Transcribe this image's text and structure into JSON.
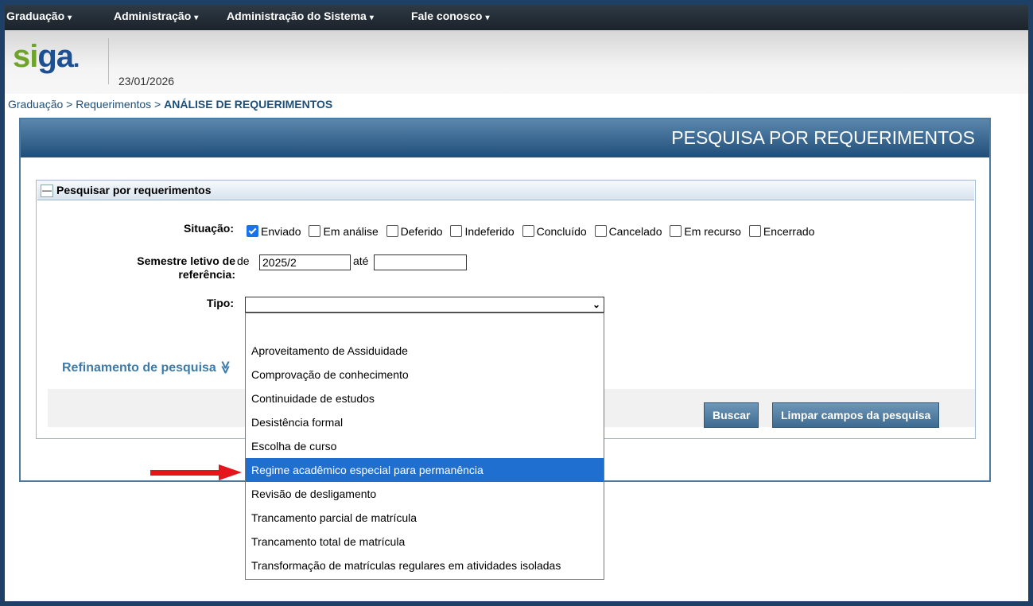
{
  "menu": {
    "items": [
      {
        "label": "Graduação"
      },
      {
        "label": "Administração"
      },
      {
        "label": "Administração do Sistema"
      },
      {
        "label": "Fale conosco"
      }
    ],
    "caret": "▾"
  },
  "header": {
    "logo_part1": "si",
    "logo_part2": "ga",
    "date": "23/01/2026"
  },
  "breadcrumb": {
    "path": "Graduação > Requerimentos > ",
    "current": "ANÁLISE DE REQUERIMENTOS"
  },
  "panel": {
    "title": "PESQUISA POR REQUERIMENTOS"
  },
  "search_form": {
    "legend": "Pesquisar por requerimentos",
    "collapse_symbol": "—",
    "situacao_label": "Situação:",
    "situacao_options": [
      {
        "label": "Enviado",
        "checked": true
      },
      {
        "label": "Em análise",
        "checked": false
      },
      {
        "label": "Deferido",
        "checked": false
      },
      {
        "label": "Indeferido",
        "checked": false
      },
      {
        "label": "Concluído",
        "checked": false
      },
      {
        "label": "Cancelado",
        "checked": false
      },
      {
        "label": "Em recurso",
        "checked": false
      },
      {
        "label": "Encerrado",
        "checked": false
      }
    ],
    "semestre_label_line1": "Semestre letivo de",
    "semestre_label_line2": "referência:",
    "de_label": "de",
    "de_value": "2025/2",
    "ate_label": "até",
    "ate_value": "",
    "tipo_label": "Tipo:",
    "tipo_value": "",
    "tipo_chevron": "⌄"
  },
  "tipo_options": [
    {
      "label": "",
      "selected": false
    },
    {
      "label": "Aproveitamento de Assiduidade",
      "selected": false
    },
    {
      "label": "Comprovação de conhecimento",
      "selected": false
    },
    {
      "label": "Continuidade de estudos",
      "selected": false
    },
    {
      "label": "Desistência formal",
      "selected": false
    },
    {
      "label": "Escolha de curso",
      "selected": false
    },
    {
      "label": "Regime acadêmico especial para permanência",
      "selected": true
    },
    {
      "label": "Revisão de desligamento",
      "selected": false
    },
    {
      "label": "Trancamento parcial de matrícula",
      "selected": false
    },
    {
      "label": "Trancamento total de matrícula",
      "selected": false
    },
    {
      "label": "Transformação de matrículas regulares em atividades isoladas",
      "selected": false
    }
  ],
  "refine": {
    "label": "Refinamento de pesquisa",
    "icon_glyph": "≫"
  },
  "buttons": {
    "search": "Buscar",
    "clear": "Limpar campos da pesquisa"
  },
  "colors": {
    "annotation_arrow": "#e3161c",
    "selected_option": "#1f6fd1"
  }
}
